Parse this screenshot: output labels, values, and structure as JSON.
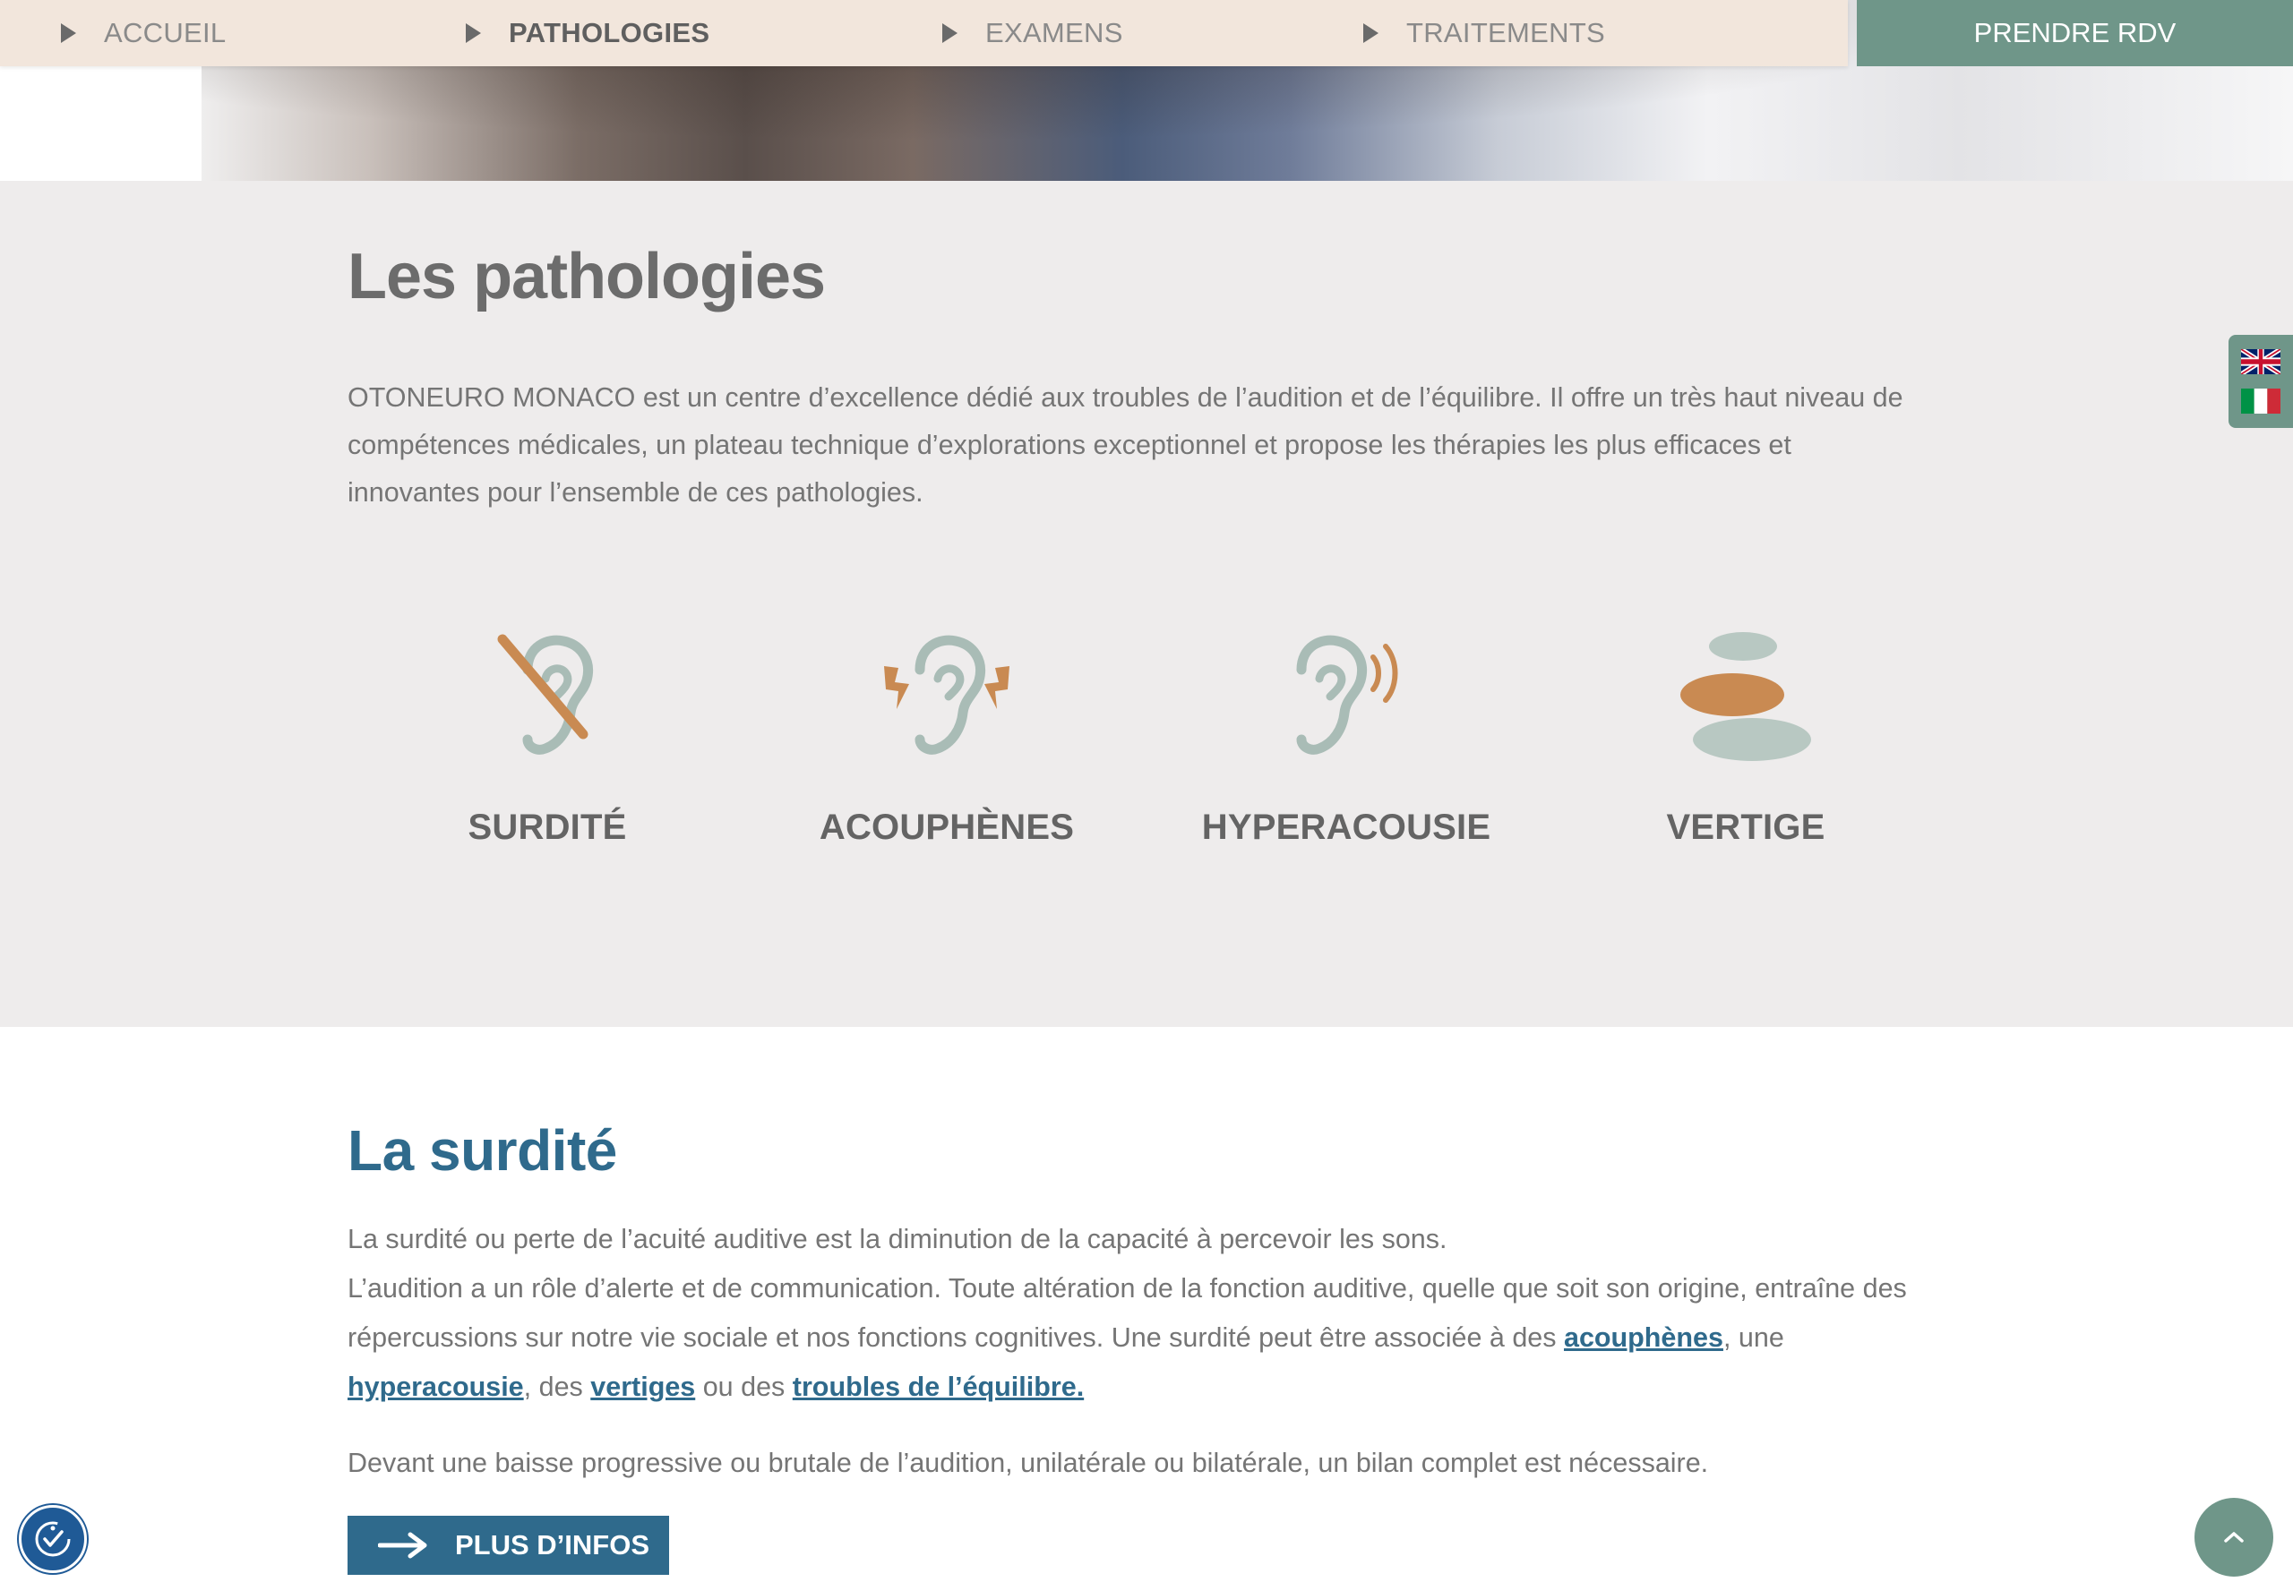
{
  "nav": {
    "items": [
      {
        "label": "ACCUEIL",
        "active": false
      },
      {
        "label": "PATHOLOGIES",
        "active": true
      },
      {
        "label": "EXAMENS",
        "active": false
      },
      {
        "label": "TRAITEMENTS",
        "active": false
      }
    ],
    "cta_label": "PRENDRE RDV"
  },
  "languages": [
    {
      "icon": "uk-flag-icon",
      "language": "English"
    },
    {
      "icon": "italy-flag-icon",
      "language": "Italiano"
    }
  ],
  "pathologies": {
    "title": "Les pathologies",
    "intro": "OTONEURO MONACO est un centre d’excellence dédié aux troubles de l’audition et de l’équilibre. Il offre un très haut niveau de compétences médicales, un plateau technique d’explorations exceptionnel et propose les thérapies les plus efficaces et innovantes pour l’ensemble de ces pathologies.",
    "cards": [
      {
        "label": "SURDITÉ",
        "icon": "crossed-ear-icon"
      },
      {
        "label": "ACOUPHÈNES",
        "icon": "ear-lightning-icon"
      },
      {
        "label": "HYPERACOUSIE",
        "icon": "ear-sound-waves-icon"
      },
      {
        "label": "VERTIGE",
        "icon": "balanced-stones-icon"
      }
    ]
  },
  "surdite": {
    "title": "La surdité",
    "p1": "La surdité ou perte de l’acuité auditive est la diminution de la capacité à percevoir les sons.",
    "p2_start": "L’audition a un rôle d’alerte et de communication. Toute altération de la fonction auditive, quelle que soit son origine, entraîne des répercussions sur notre vie sociale et nos fonctions cognitives. Une surdité peut être associée à des ",
    "link_acouphenes": "acouphènes",
    "p2_after_acouphenes": ", une ",
    "link_hyperacousie": "hyperacousie",
    "p2_after_hyperacousie": ", des ",
    "link_vertiges": "vertiges",
    "p2_after_vertiges": " ou des ",
    "link_troubles": "troubles de l’équilibre.",
    "p3": "Devant une baisse progressive ou brutale de l’audition, unilatérale ou bilatérale, un bilan complet est nécessaire.",
    "button_label": "PLUS D’INFOS"
  },
  "colors": {
    "accent_blue": "#2f6a8c",
    "sage": "#6f9689",
    "nav_bg": "#f2e6dc",
    "icon_grey": "#a9bcb6",
    "icon_orange": "#c98a52"
  }
}
